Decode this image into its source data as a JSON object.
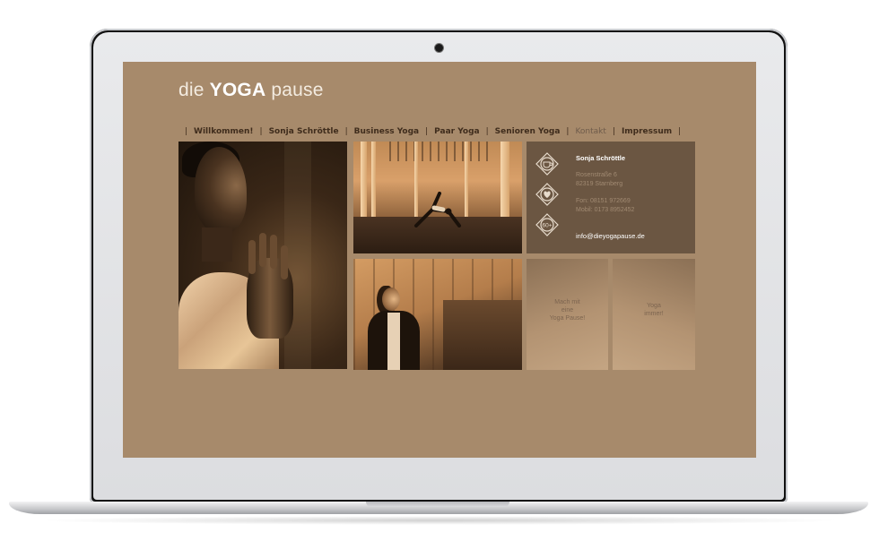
{
  "site": {
    "logo": {
      "pre": "die",
      "bold": "YOGA",
      "post": "pause"
    }
  },
  "nav": {
    "separator": "|",
    "items": [
      {
        "label": "Willkommen!",
        "active": false
      },
      {
        "label": "Sonja Schröttle",
        "active": false
      },
      {
        "label": "Business Yoga",
        "active": false
      },
      {
        "label": "Paar Yoga",
        "active": false
      },
      {
        "label": "Senioren Yoga",
        "active": false
      },
      {
        "label": "Kontakt",
        "active": true
      },
      {
        "label": "Impressum",
        "active": false
      }
    ]
  },
  "contact": {
    "name": "Sonja Schröttle",
    "street": "Rosenstraße 6",
    "city": "82319 Starnberg",
    "phone": "Fon: 08151 972669",
    "mobile": "Mobil: 0173 8952452",
    "email": "info@dieyogapause.de",
    "icons": [
      "tea-cup-icon",
      "heart-icon",
      "60-plus-icon"
    ]
  },
  "promo": {
    "left": [
      "Mach mit",
      "eine",
      "Yoga Pause!"
    ],
    "right": [
      "Yoga",
      "immer!"
    ]
  },
  "colors": {
    "page_bg": "#a78a6b",
    "contact_bg": "#6b5642",
    "nav_text": "#3f2c1c",
    "nav_active": "#6f5c4b"
  }
}
